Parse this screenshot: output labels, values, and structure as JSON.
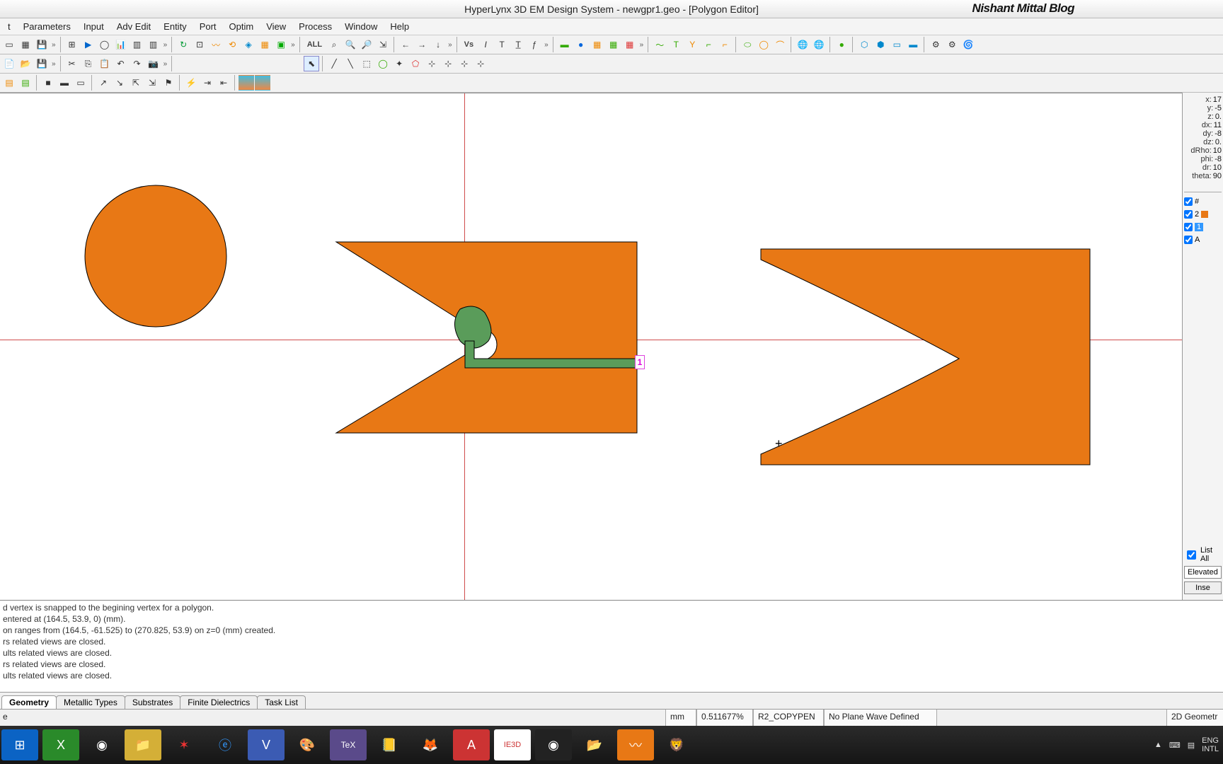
{
  "title": "HyperLynx 3D EM Design System - newgpr1.geo - [Polygon Editor]",
  "blog_label": "Nishant Mittal Blog",
  "menu": [
    "t",
    "Parameters",
    "Input",
    "Adv Edit",
    "Entity",
    "Port",
    "Optim",
    "View",
    "Process",
    "Window",
    "Help"
  ],
  "coords": {
    "x_label": "x:",
    "x": "17",
    "y_label": "y:",
    "y": "-5",
    "z_label": "z:",
    "z": "0.",
    "dx_label": "dx:",
    "dx": "11",
    "dy_label": "dy:",
    "dy": "-8",
    "dz_label": "dz:",
    "dz": "0.",
    "dRho_label": "dRho:",
    "dRho": "10",
    "phi_label": "phi:",
    "phi": "-8",
    "dr_label": "dr:",
    "dr": "10",
    "theta_label": "theta:",
    "theta": "90"
  },
  "layers": {
    "header_check": true,
    "header_hash": "#",
    "rows": [
      {
        "checked": true,
        "label": "2"
      },
      {
        "checked": true,
        "label": "1",
        "selected": true
      },
      {
        "checked": true,
        "label": "A"
      }
    ]
  },
  "panel_controls": {
    "list_all_checked": true,
    "list_all_label": "List All",
    "mode_value": "Elevated",
    "insert_label": "Inse"
  },
  "port_marker": "1",
  "log_lines": [
    "d vertex is snapped to the begining vertex for a polygon.",
    "entered at (164.5, 53.9, 0) (mm).",
    "on ranges from (164.5, -61.525) to (270.825, 53.9) on z=0 (mm) created.",
    "rs related views are closed.",
    "ults related views are closed.",
    "rs related views are closed.",
    "ults related views are closed."
  ],
  "tabs": [
    "Geometry",
    "Metallic Types",
    "Substrates",
    "Finite Dielectrics",
    "Task List"
  ],
  "active_tab": 0,
  "status": {
    "left": "e",
    "unit": "mm",
    "zoom": "0.511677%",
    "mode": "R2_COPYPEN",
    "plane": "No Plane Wave Defined",
    "right": "2D Geometr"
  },
  "toolbar_text": {
    "all": "ALL",
    "vs": "Vs"
  },
  "taskbar_right": {
    "lang1": "ENG",
    "lang2": "INTL"
  }
}
